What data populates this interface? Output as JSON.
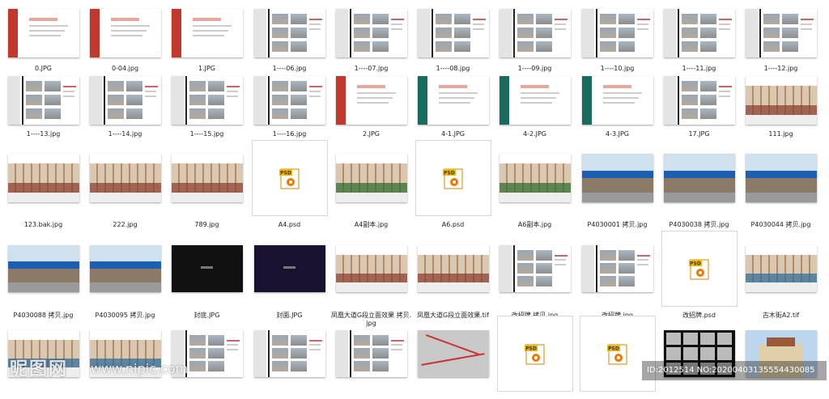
{
  "files": [
    {
      "label": "0.JPG",
      "kind": "doc",
      "accent": "#c0392b"
    },
    {
      "label": "0-04.jpg",
      "kind": "doc",
      "accent": "#c0392b"
    },
    {
      "label": "1.JPG",
      "kind": "doc",
      "accent": "#c0392b"
    },
    {
      "label": "1----06.jpg",
      "kind": "photo",
      "accent": "#333"
    },
    {
      "label": "1----07.jpg",
      "kind": "photo",
      "accent": "#333"
    },
    {
      "label": "1----08.jpg",
      "kind": "photo",
      "accent": "#333"
    },
    {
      "label": "1----09.jpg",
      "kind": "photo",
      "accent": "#333"
    },
    {
      "label": "1----10.jpg",
      "kind": "photo",
      "accent": "#333"
    },
    {
      "label": "1----11.jpg",
      "kind": "photo",
      "accent": "#333"
    },
    {
      "label": "1----12.jpg",
      "kind": "photo",
      "accent": "#333"
    },
    {
      "label": "1----13.jpg",
      "kind": "photo",
      "accent": "#333"
    },
    {
      "label": "1----14.jpg",
      "kind": "photo",
      "accent": "#333"
    },
    {
      "label": "1----15.jpg",
      "kind": "photo",
      "accent": "#333"
    },
    {
      "label": "1----16.jpg",
      "kind": "photo",
      "accent": "#333"
    },
    {
      "label": "2.JPG",
      "kind": "doc",
      "accent": "#c0392b"
    },
    {
      "label": "4-1.JPG",
      "kind": "doc",
      "accent": "#1a6b5f"
    },
    {
      "label": "4-2.JPG",
      "kind": "doc",
      "accent": "#1a6b5f"
    },
    {
      "label": "4-3.JPG",
      "kind": "doc",
      "accent": "#1a6b5f"
    },
    {
      "label": "17.JPG",
      "kind": "photo",
      "accent": "#333"
    },
    {
      "label": "111.jpg",
      "kind": "facade",
      "accent": "#8a3b2b"
    },
    {
      "label": "123.bak.jpg",
      "kind": "facade",
      "accent": "#8a3b2b"
    },
    {
      "label": "222.jpg",
      "kind": "facade",
      "accent": "#8a3b2b"
    },
    {
      "label": "789.jpg",
      "kind": "facade",
      "accent": "#8a3b2b"
    },
    {
      "label": "A4.psd",
      "kind": "psd",
      "accent": "#f0a000"
    },
    {
      "label": "A4副本.jpg",
      "kind": "facade",
      "accent": "#2a6a2a"
    },
    {
      "label": "A6.psd",
      "kind": "psd",
      "accent": "#f0a000"
    },
    {
      "label": "A6副本.jpg",
      "kind": "facade",
      "accent": "#2a6a2a"
    },
    {
      "label": "P4030001 拷贝.jpg",
      "kind": "street",
      "accent": "#1a5fb4"
    },
    {
      "label": "P4030038 拷贝.jpg",
      "kind": "street",
      "accent": "#1a5fb4"
    },
    {
      "label": "P4030044 拷贝.jpg",
      "kind": "street",
      "accent": "#1a5fb4"
    },
    {
      "label": "P4030088 拷贝.jpg",
      "kind": "street",
      "accent": "#1a5fb4"
    },
    {
      "label": "P4030095 拷贝.jpg",
      "kind": "street",
      "accent": "#1a5fb4"
    },
    {
      "label": "封底.JPG",
      "kind": "dark",
      "accent": "#111"
    },
    {
      "label": "封面.JPG",
      "kind": "dark",
      "accent": "#1a1030"
    },
    {
      "label": "凤凰大道G段立面效果 拷贝.jpg",
      "kind": "facade",
      "accent": "#8a3b2b"
    },
    {
      "label": "凤凰大道G段立面效果.tif",
      "kind": "facade",
      "accent": "#8a3b2b"
    },
    {
      "label": "改招牌 拷贝.jpg",
      "kind": "photo",
      "accent": "#333"
    },
    {
      "label": "改招牌.jpg",
      "kind": "photo",
      "accent": "#333"
    },
    {
      "label": "改招牌.psd",
      "kind": "psd",
      "accent": "#f0a000"
    },
    {
      "label": "古木街A2.tif",
      "kind": "facade",
      "accent": "#2a6a9a"
    },
    {
      "label": "",
      "kind": "facade",
      "accent": "#2a6a9a"
    },
    {
      "label": "",
      "kind": "facade",
      "accent": "#2a6a9a"
    },
    {
      "label": "",
      "kind": "photo",
      "accent": "#333"
    },
    {
      "label": "",
      "kind": "photo",
      "accent": "#333"
    },
    {
      "label": "",
      "kind": "photo",
      "accent": "#333"
    },
    {
      "label": "",
      "kind": "map",
      "accent": "#c33"
    },
    {
      "label": "",
      "kind": "psd",
      "accent": "#f0a000"
    },
    {
      "label": "",
      "kind": "psd",
      "accent": "#f0a000"
    },
    {
      "label": "",
      "kind": "collage",
      "accent": "#222"
    },
    {
      "label": "",
      "kind": "building",
      "accent": "#3a7ab8"
    }
  ],
  "psd_badge": "PSD",
  "watermark": {
    "logo": "昵图网",
    "url": "www.nipic.com",
    "id": "ID:2012514 NO:20200403135554430085"
  }
}
